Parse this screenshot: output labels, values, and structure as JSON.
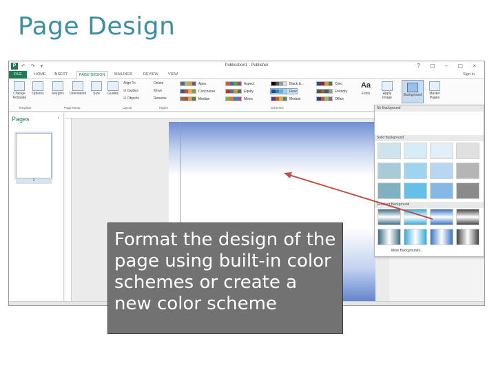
{
  "slide": {
    "title": "Page Design"
  },
  "window": {
    "title": "Publication1 - Publisher",
    "app_icon": "P",
    "qat": "↶ ↷ ▾",
    "controls": "? ▢ – ▢ ×"
  },
  "ribbon_tabs": [
    {
      "label": "FILE",
      "active": false
    },
    {
      "label": "HOME",
      "active": false
    },
    {
      "label": "INSERT",
      "active": false
    },
    {
      "label": "PAGE DESIGN",
      "active": true
    },
    {
      "label": "MAILINGS",
      "active": false
    },
    {
      "label": "REVIEW",
      "active": false
    },
    {
      "label": "VIEW",
      "active": false
    }
  ],
  "sign_in": "Sign in",
  "ribbon": {
    "buttons": {
      "change_template": "Change Template",
      "options": "Options",
      "margins": "Margins",
      "orientation": "Orientation",
      "size": "Size",
      "guides": "Guides",
      "apply_image": "Apply Image",
      "background": "Background",
      "master_pages": "Master Pages",
      "fonts": "Fonts"
    },
    "layout_items": [
      "Align To",
      "Guides",
      "Objects"
    ],
    "pages_items": [
      "Delete",
      "Move",
      "Rename"
    ],
    "groups": {
      "template": "Template",
      "page_setup": "Page Setup",
      "layout": "Layout",
      "pages": "Pages",
      "schemes": "Schemes"
    },
    "schemes_col1": [
      "Apex",
      "Concourse",
      "Median"
    ],
    "schemes_col2": [
      "Aspect",
      "Equity",
      "Metro"
    ],
    "schemes_col3": [
      "Black &...",
      "Flow",
      "Module"
    ],
    "schemes_col4": [
      "Civic",
      "Foundry",
      "Office"
    ]
  },
  "pages_pane": {
    "title": "Pages",
    "collapse": "‹",
    "page_number": "1"
  },
  "background_panel": {
    "no_background": "No Background",
    "solid_background": "Solid Background",
    "gradient_background": "Gradient Background",
    "more_backgrounds": "More Backgrounds...",
    "solid_colors": [
      "#cfe3ec",
      "#d6ecf7",
      "#e2eef8",
      "#e0e0e0",
      "#a9cbd8",
      "#9ed4ee",
      "#b8d6f1",
      "#b5b5b5",
      "#7fb1c3",
      "#63c0e8",
      "#86b8e6",
      "#8a8a8a"
    ],
    "gradient_colors": [
      "#3f6f86",
      "#3aa9d6",
      "#3a73c4",
      "#444444"
    ]
  },
  "callout": {
    "text": "Format the design of the page using built-in color schemes or create a new color scheme"
  },
  "colors": {
    "title": "#3f8ea0",
    "accent": "#1f7a54",
    "arrow": "#c0504d",
    "callout_bg": "#727272"
  }
}
